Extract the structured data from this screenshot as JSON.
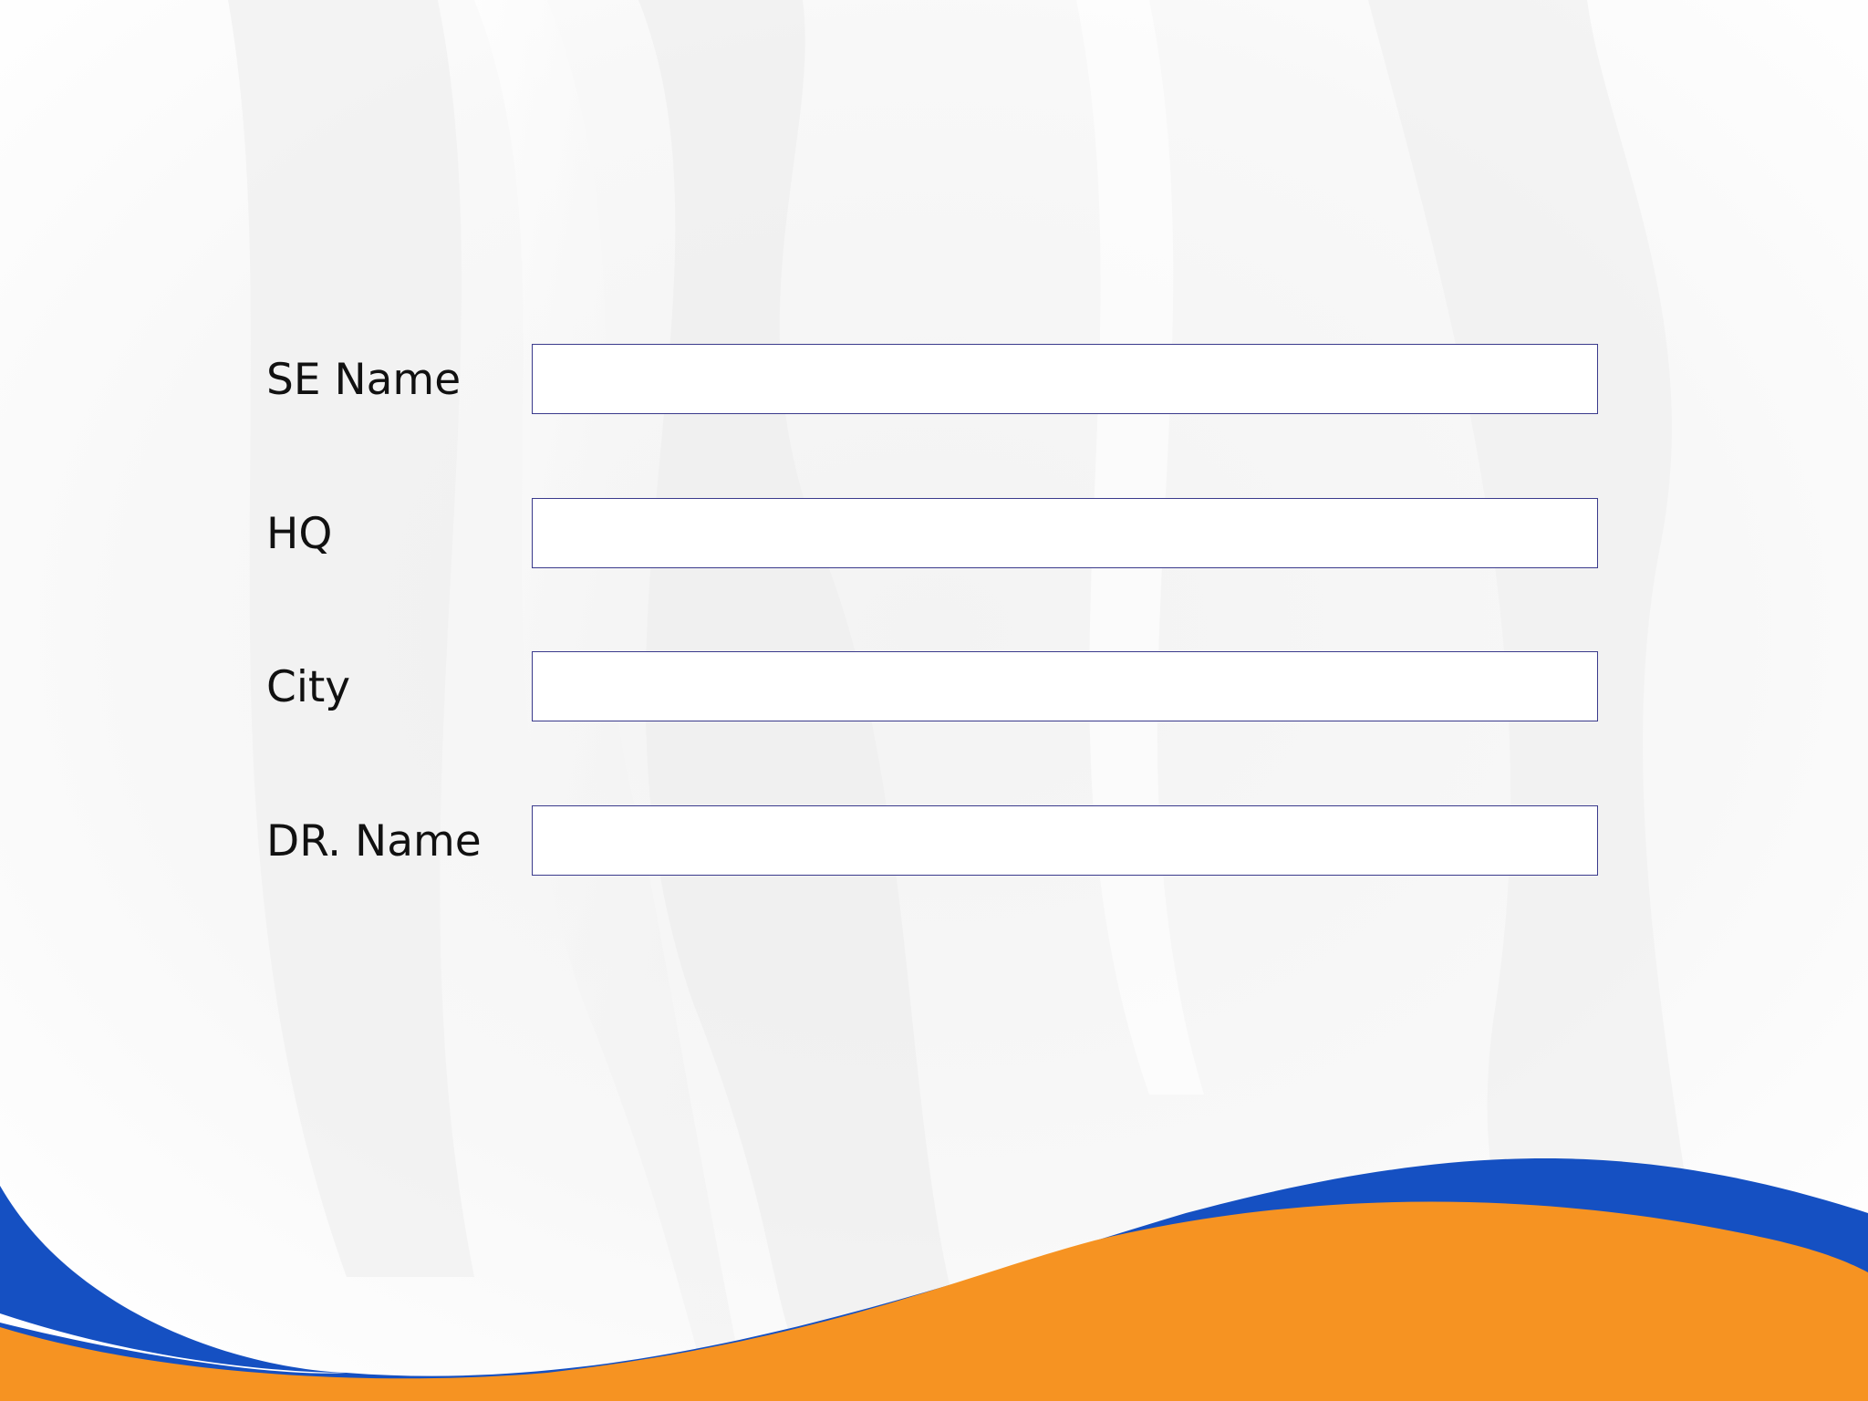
{
  "form": {
    "fields": [
      {
        "label": "SE Name",
        "value": "",
        "placeholder": ""
      },
      {
        "label": "HQ",
        "value": "",
        "placeholder": ""
      },
      {
        "label": "City",
        "value": "",
        "placeholder": ""
      },
      {
        "label": "DR. Name",
        "value": "",
        "placeholder": ""
      }
    ]
  },
  "colors": {
    "background": "#f7f7f7",
    "field_border": "#3a3a8c",
    "field_fill": "#ffffff",
    "wave_blue": "#1550c2",
    "wave_orange": "#f69322",
    "label_text": "#111111"
  }
}
